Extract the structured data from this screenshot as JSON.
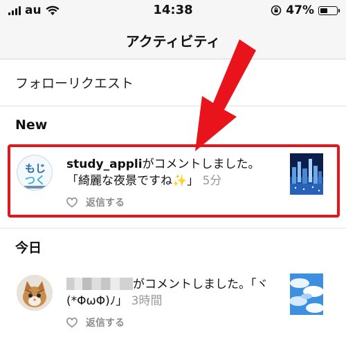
{
  "status_bar": {
    "carrier": "au",
    "time": "14:38",
    "battery_percent_label": "47%",
    "battery_level": 0.47
  },
  "nav": {
    "title": "アクティビティ"
  },
  "follow_requests": {
    "label": "フォローリクエスト"
  },
  "sections": {
    "new_label": "New",
    "today_label": "今日"
  },
  "notifications": [
    {
      "username": "study_appli",
      "action": "がコメントしました。",
      "comment": "「綺麗な夜景ですね✨」",
      "time": "5分",
      "reply_label": "返信する",
      "avatar_text_top": "もじ",
      "avatar_text_bottom": "つく"
    },
    {
      "action": "がコメントしました。「ヾ",
      "comment": "(*ΦωΦ)ﾉ」",
      "time": "3時間",
      "reply_label": "返信する"
    }
  ],
  "colors": {
    "highlight": "#e8131b",
    "accent_text": "#2c6aa8"
  }
}
